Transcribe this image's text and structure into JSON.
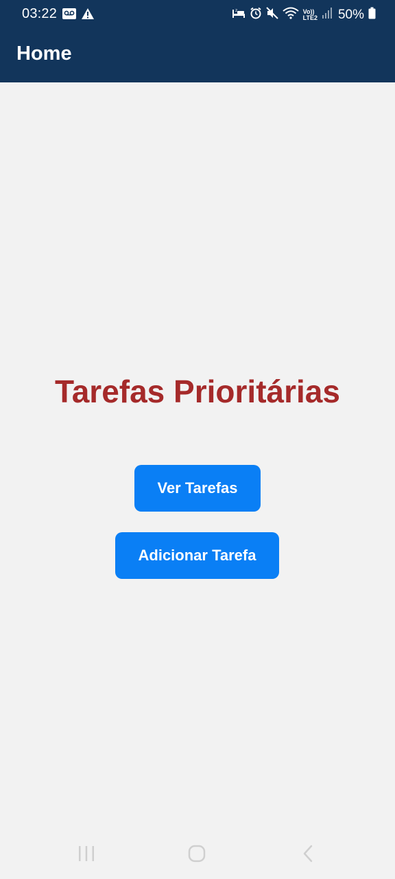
{
  "status_bar": {
    "time": "03:22",
    "left_icons": [
      "voicemail-icon",
      "warning-icon"
    ],
    "right_icons": [
      "bed-icon",
      "alarm-icon",
      "mute-icon",
      "wifi-icon",
      "volte-icon",
      "signal-icon",
      "battery-icon"
    ],
    "volte_line1": "Vo))",
    "volte_line2": "LTE2",
    "battery": "50%"
  },
  "app_bar": {
    "title": "Home"
  },
  "main": {
    "title": "Tarefas Prioritárias",
    "view_tasks_label": "Ver Tarefas",
    "add_task_label": "Adicionar Tarefa"
  },
  "colors": {
    "app_bar_bg": "#12355b",
    "title_red": "#a52a2a",
    "button_blue": "#0a7ff5",
    "background": "#f2f2f2"
  },
  "nav_bar": {
    "buttons": [
      "recents-icon",
      "home-icon",
      "back-icon"
    ]
  }
}
